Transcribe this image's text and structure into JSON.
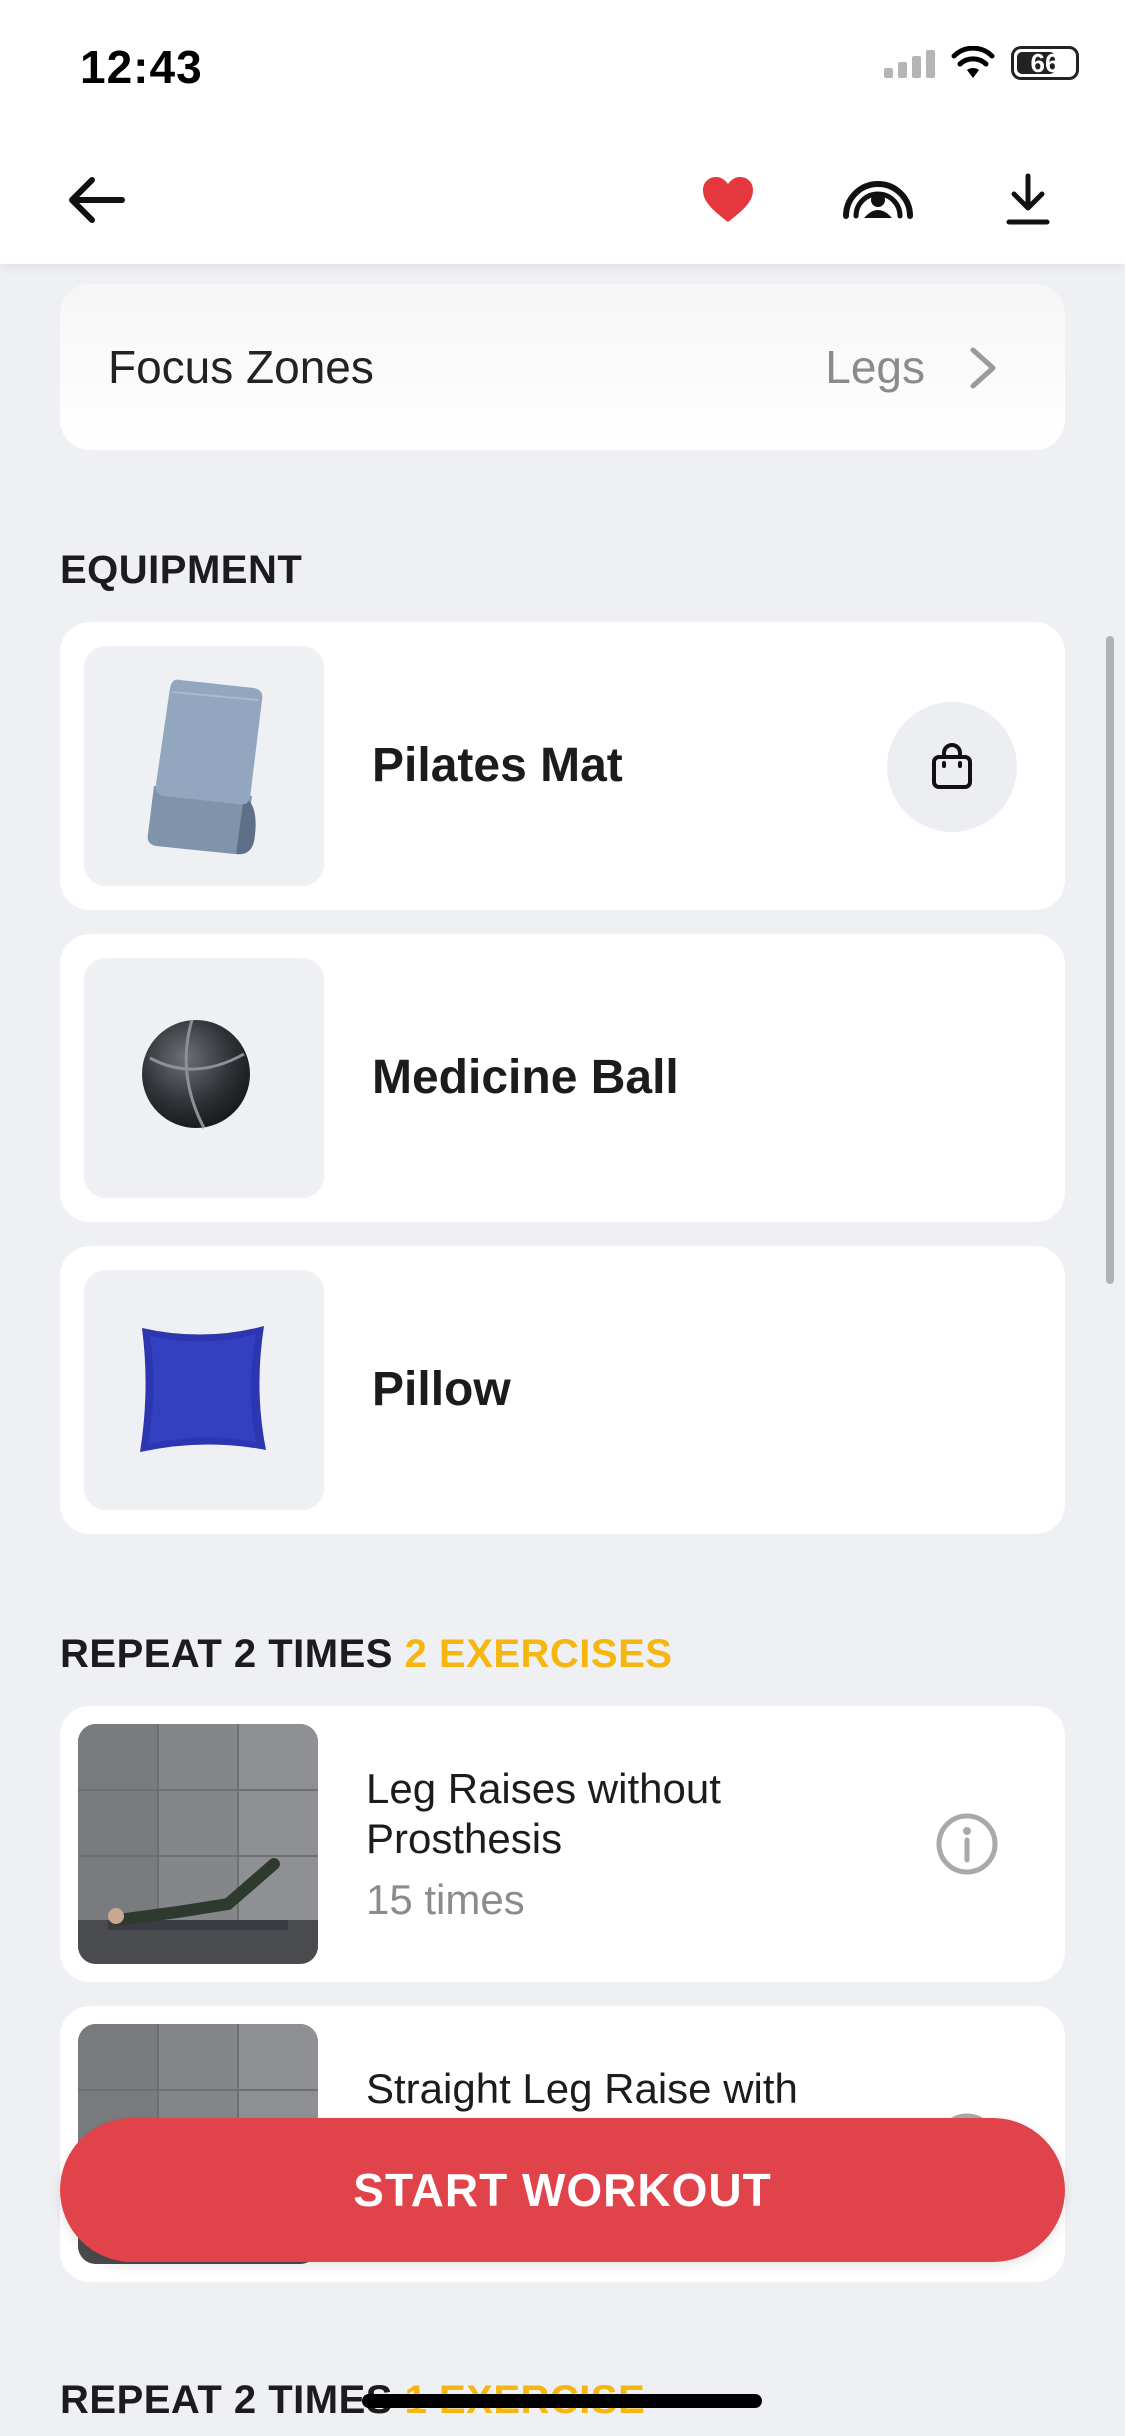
{
  "status_bar": {
    "time": "12:43",
    "battery": "66",
    "battery_level": 0.66,
    "icons": [
      "cellular-signal-icon",
      "wifi-icon",
      "battery-icon"
    ]
  },
  "nav": {
    "icons": [
      "arrow-left-icon",
      "heart-icon",
      "cast-icon",
      "download-icon"
    ],
    "favorite_color": "#e5383e"
  },
  "focus_zones": {
    "label": "Focus Zones",
    "value": "Legs",
    "icon": "chevron-right-icon"
  },
  "equipment": {
    "title": "EQUIPMENT",
    "items": [
      {
        "name": "Pilates Mat",
        "icon": "shopping-bag-icon"
      },
      {
        "name": "Medicine Ball"
      },
      {
        "name": "Pillow"
      }
    ]
  },
  "block1": {
    "title": "REPEAT 2 TIMES",
    "count": "2 EXERCISES",
    "exercises": [
      {
        "title": "Leg Raises without Prosthesis",
        "sub": "15 times",
        "icon": "info-icon"
      },
      {
        "title": "Straight Leg Raise with",
        "sub": "",
        "icon": "info-icon"
      }
    ]
  },
  "block2": {
    "title": "REPEAT 2 TIMES",
    "count": "1 EXERCISE"
  },
  "cta": {
    "label": "START WORKOUT",
    "color": "#e0434a"
  },
  "colors": {
    "accent": "#f5b70f",
    "background": "#eef0f4"
  }
}
